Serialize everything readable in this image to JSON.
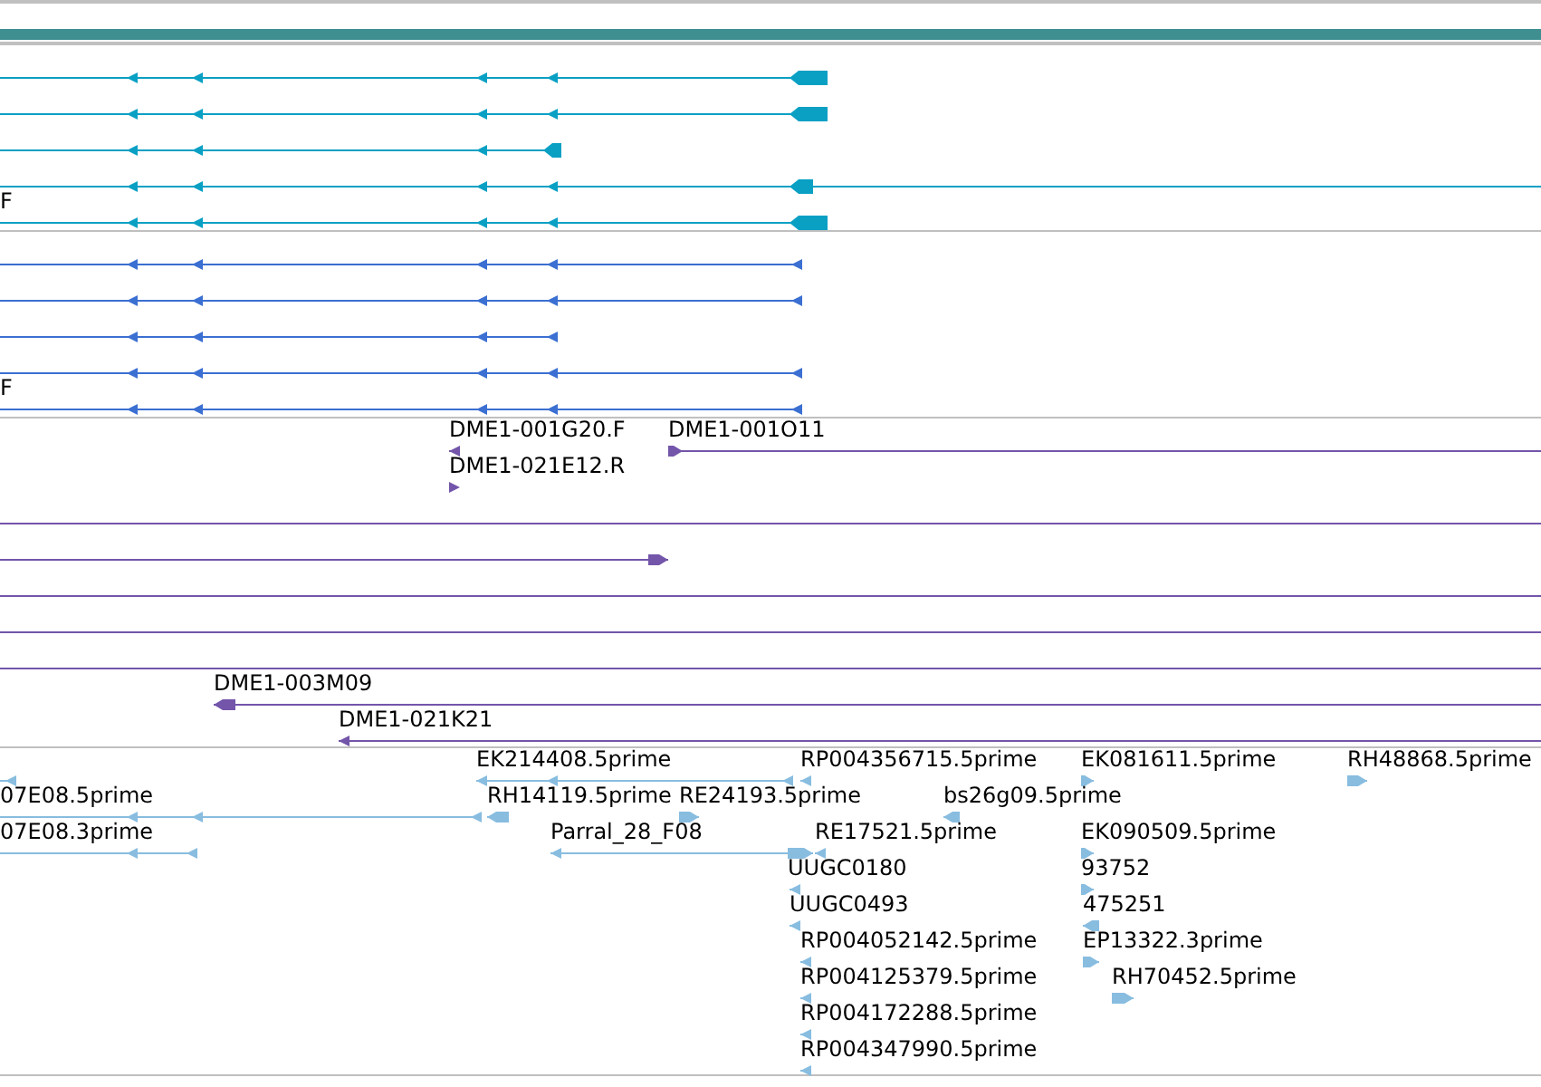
{
  "tracks": [
    {
      "color": "#0aa0c4",
      "labels": [
        "F"
      ]
    },
    {
      "color": "#3b6fd2",
      "labels": [
        "F"
      ]
    },
    {
      "color": "#7355aa",
      "labels": [
        "DME1-001G20.F",
        "DME1-021E12.R",
        "DME1-001O11",
        "DME1-003M09",
        "DME1-021K21"
      ]
    },
    {
      "color": "#88bde0",
      "labels": [
        "EK214408.5prime",
        "RP004356715.5prime",
        "EK081611.5prime",
        "RH48868.5prime",
        "07E08.5prime",
        "RH14119.5prime",
        "RE24193.5prime",
        "bs26g09.5prime",
        "07E08.3prime",
        "Parral_28_F08",
        "RE17521.5prime",
        "EK090509.5prime",
        "UUGC0180",
        "93752",
        "UUGC0493",
        "475251",
        "RP004052142.5prime",
        "EP13322.3prime",
        "RP004125379.5prime",
        "RH70452.5prime",
        "RP004172288.5prime",
        "RP004347990.5prime"
      ]
    }
  ]
}
